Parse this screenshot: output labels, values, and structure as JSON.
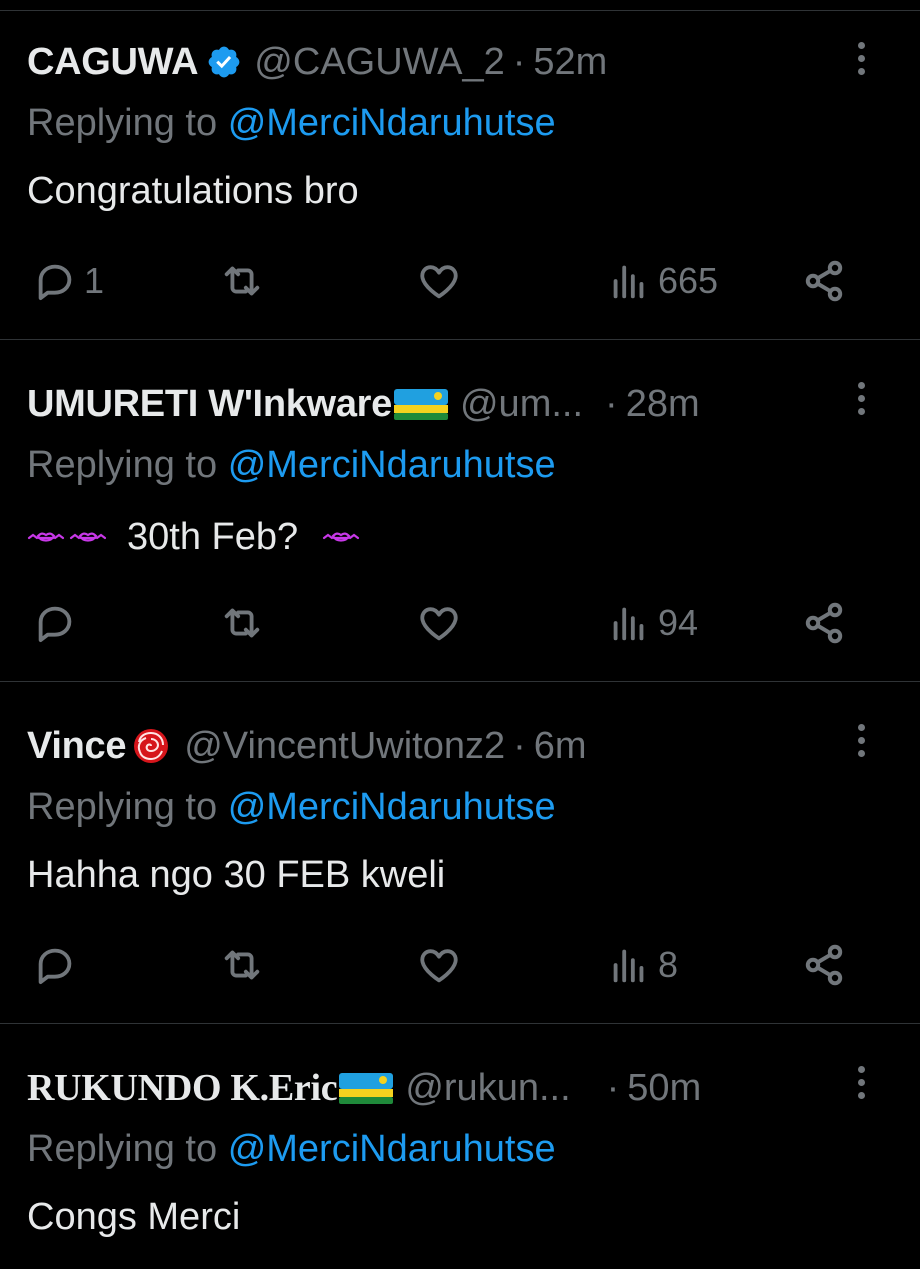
{
  "reply_prefix": "Replying to",
  "replies": [
    {
      "name": "CAGUWA",
      "handle": "@CAGUWA_2",
      "time": "52m",
      "mention": "@MerciNdaruhutse",
      "text": "Congratulations bro",
      "verified": true,
      "metrics": {
        "replies": "1",
        "views": "665"
      }
    },
    {
      "name": "UMURETI W'Inkware",
      "handle": "@um...",
      "time": "28m",
      "mention": "@MerciNdaruhutse",
      "text": "30th Feb?",
      "metrics": {
        "replies": "",
        "views": "94"
      }
    },
    {
      "name": "Vince",
      "handle": "@VincentUwitonz2",
      "time": "6m",
      "mention": "@MerciNdaruhutse",
      "text": "Hahha ngo 30 FEB kweli",
      "metrics": {
        "replies": "",
        "views": "8"
      }
    },
    {
      "name": "RUKUNDO K.Eric",
      "handle": "@rukun...",
      "time": "50m",
      "mention": "@MerciNdaruhutse",
      "text": "Congs Merci"
    }
  ],
  "colors": {
    "background": "#000000",
    "text": "#e7e9ea",
    "secondary": "#71767b",
    "accent": "#1d9bf0",
    "divider": "#2f3336"
  },
  "icons": [
    "verified-badge-icon",
    "rwanda-flag-icon",
    "rose-icon",
    "kissing-lips-emoji-icon",
    "reply-icon",
    "retweet-icon",
    "like-icon",
    "views-icon",
    "share-icon",
    "more-icon"
  ]
}
